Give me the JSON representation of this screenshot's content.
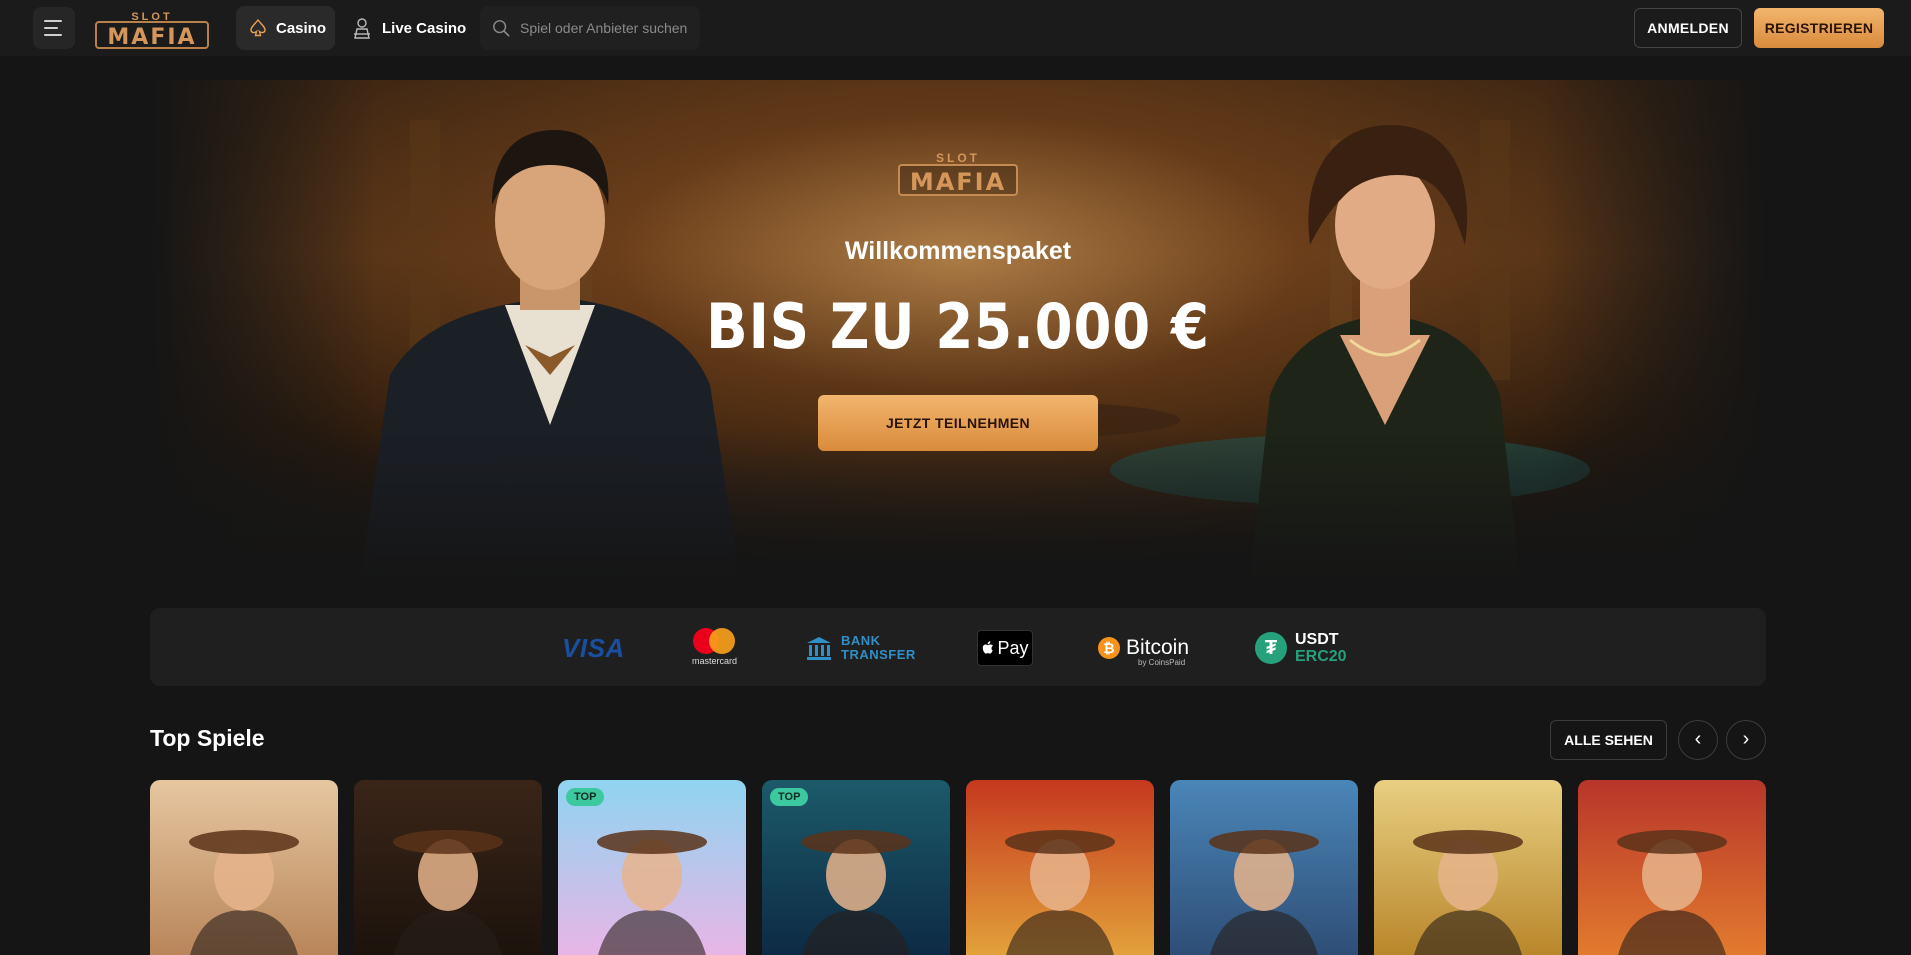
{
  "header": {
    "brand": "SLOT MAFIA",
    "nav": {
      "casino": "Casino",
      "live_casino": "Live Casino"
    },
    "search": {
      "placeholder": "Spiel oder Anbieter suchen"
    },
    "login_label": "ANMELDEN",
    "register_label": "REGISTRIEREN"
  },
  "hero": {
    "brand": "SLOT MAFIA",
    "title": "Willkommenspaket",
    "amount": "BIS ZU 25.000 €",
    "cta_label": "JETZT TEILNEHMEN"
  },
  "payments": {
    "visa": "VISA",
    "mastercard": "mastercard",
    "bank_transfer": [
      "BANK",
      "TRANSFER"
    ],
    "apple_pay": "Pay",
    "bitcoin": "Bitcoin",
    "bitcoin_sub": "by CoinsPaid",
    "usdt": [
      "USDT",
      "ERC20"
    ]
  },
  "top_games": {
    "title": "Top Spiele",
    "see_all_label": "ALLE SEHEN",
    "prev_icon": "chevron-left-icon",
    "next_icon": "chevron-right-icon",
    "games": [
      {
        "badge": "",
        "palette": [
          "#e6c7a0",
          "#b9855a"
        ]
      },
      {
        "badge": "",
        "palette": [
          "#3a2518",
          "#1c130c"
        ]
      },
      {
        "badge": "TOP",
        "palette": [
          "#8fd4f0",
          "#e8b6e6"
        ]
      },
      {
        "badge": "TOP",
        "palette": [
          "#1c5a6a",
          "#0d2a44"
        ]
      },
      {
        "badge": "",
        "palette": [
          "#c5381e",
          "#e2a13a"
        ]
      },
      {
        "badge": "",
        "palette": [
          "#4a86b8",
          "#2e4e76"
        ]
      },
      {
        "badge": "",
        "palette": [
          "#e8cf82",
          "#b9872b"
        ]
      },
      {
        "badge": "",
        "palette": [
          "#b8352a",
          "#e27a2e"
        ]
      }
    ]
  },
  "colors": {
    "accent_gold": "#e8a055",
    "background": "#151515",
    "top_badge": "#3cc9a0"
  }
}
